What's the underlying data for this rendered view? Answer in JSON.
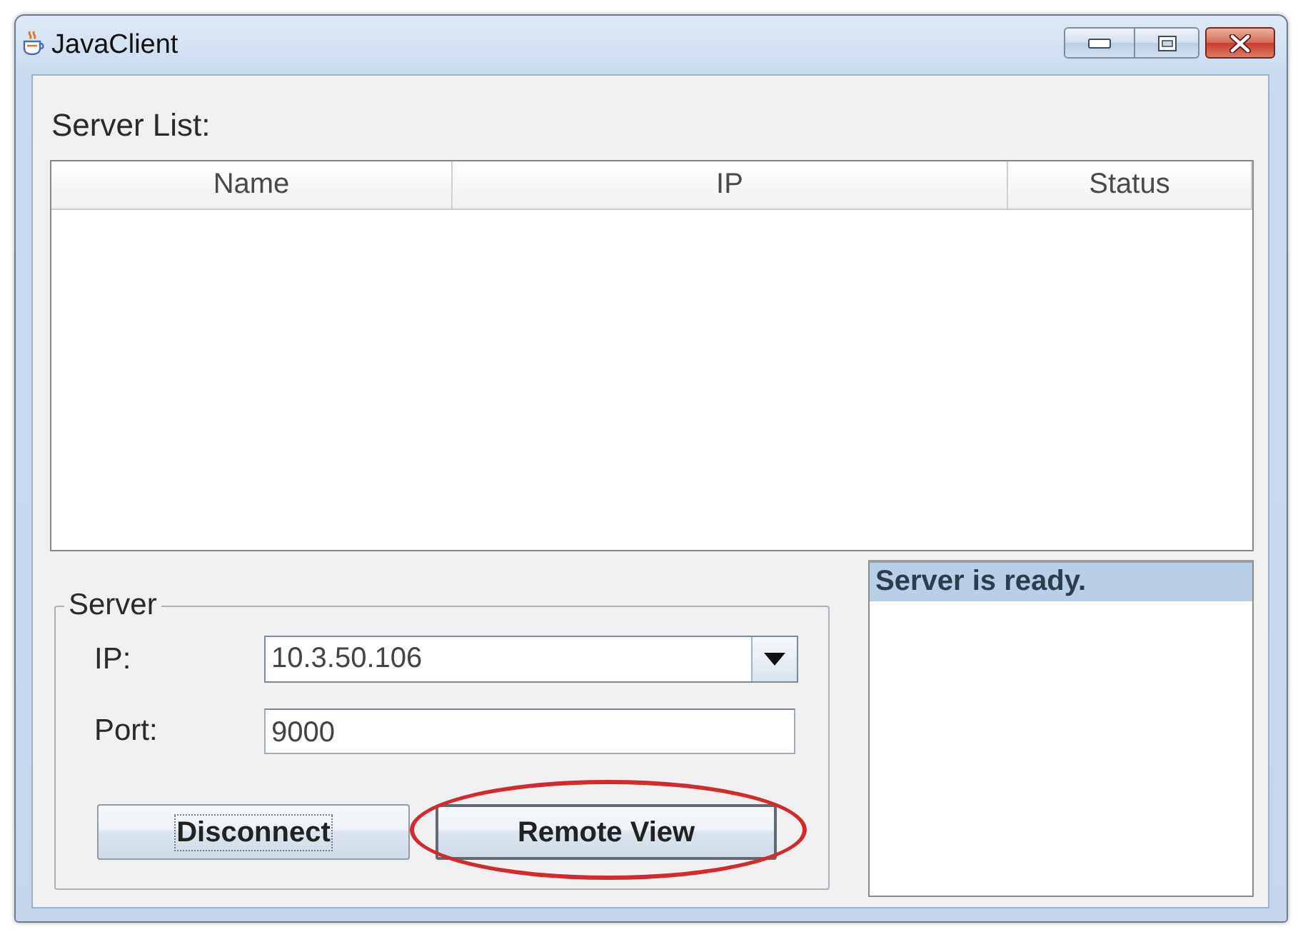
{
  "window": {
    "title": "JavaClient"
  },
  "server_list": {
    "label": "Server List:",
    "columns": [
      "Name",
      "IP",
      "Status"
    ]
  },
  "server": {
    "title": "Server",
    "fields": [
      {
        "kind": "combo",
        "label": "IP:",
        "value": "10.3.50.106"
      },
      {
        "kind": "text",
        "label": "Port:",
        "value": "9000"
      }
    ],
    "buttons": [
      {
        "label": "Disconnect",
        "focused": true,
        "default": false,
        "circled": false
      },
      {
        "label": "Remote View",
        "focused": false,
        "default": true,
        "circled": true
      }
    ]
  },
  "log": {
    "items": [
      {
        "text": "Server is ready.",
        "selected": true
      }
    ]
  }
}
